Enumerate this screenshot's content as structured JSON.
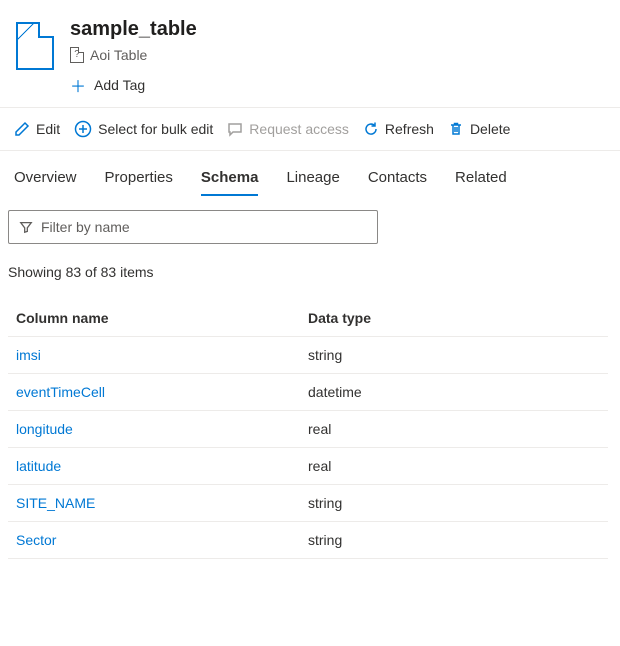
{
  "header": {
    "title": "sample_table",
    "subtitle": "Aoi Table",
    "add_tag_label": "Add Tag"
  },
  "toolbar": {
    "edit": "Edit",
    "bulk": "Select for bulk edit",
    "request": "Request access",
    "refresh": "Refresh",
    "delete": "Delete"
  },
  "tabs": {
    "items": [
      {
        "label": "Overview"
      },
      {
        "label": "Properties"
      },
      {
        "label": "Schema"
      },
      {
        "label": "Lineage"
      },
      {
        "label": "Contacts"
      },
      {
        "label": "Related"
      }
    ],
    "active_index": 2
  },
  "filter": {
    "placeholder": "Filter by name",
    "value": ""
  },
  "count_text": "Showing 83 of 83 items",
  "columns": {
    "name_header": "Column name",
    "type_header": "Data type",
    "rows": [
      {
        "name": "imsi",
        "type": "string"
      },
      {
        "name": "eventTimeCell",
        "type": "datetime"
      },
      {
        "name": "longitude",
        "type": "real"
      },
      {
        "name": "latitude",
        "type": "real"
      },
      {
        "name": "SITE_NAME",
        "type": "string"
      },
      {
        "name": "Sector",
        "type": "string"
      }
    ]
  }
}
